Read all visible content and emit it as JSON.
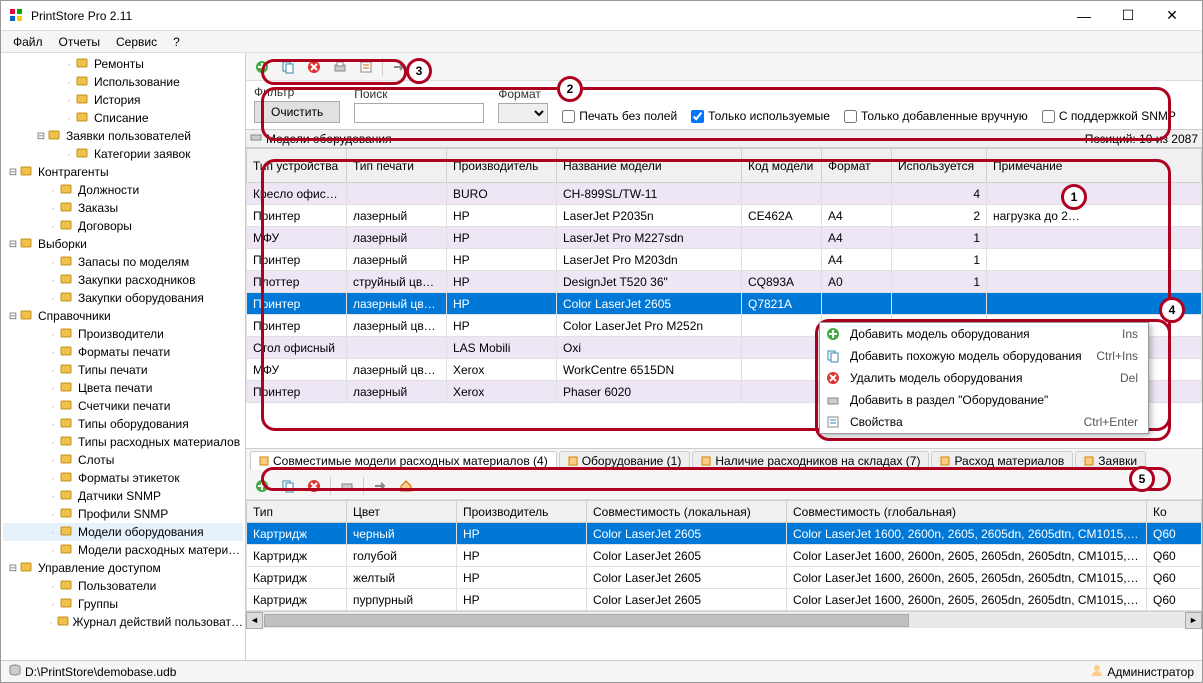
{
  "window": {
    "title": "PrintStore Pro 2.11"
  },
  "menu": {
    "file": "Файл",
    "reports": "Отчеты",
    "service": "Сервис",
    "help": "?"
  },
  "tree": [
    {
      "l": 2,
      "label": "Ремонты",
      "ico": "wrench"
    },
    {
      "l": 2,
      "label": "Использование",
      "ico": "doc"
    },
    {
      "l": 2,
      "label": "История",
      "ico": "time"
    },
    {
      "l": 2,
      "label": "Списание",
      "ico": "doc"
    },
    {
      "l": 1,
      "exp": "-",
      "label": "Заявки пользователей",
      "ico": "folder"
    },
    {
      "l": 2,
      "label": "Категории заявок",
      "ico": "tag"
    },
    {
      "l": 0,
      "exp": "-",
      "label": "Контрагенты",
      "ico": "contacts"
    },
    {
      "l": "1nb",
      "label": "Должности",
      "ico": "card"
    },
    {
      "l": "1nb",
      "label": "Заказы",
      "ico": "cart"
    },
    {
      "l": "1nb",
      "label": "Договоры",
      "ico": "doc"
    },
    {
      "l": 0,
      "exp": "-",
      "label": "Выборки",
      "ico": "filter"
    },
    {
      "l": "1nb",
      "label": "Запасы по моделям",
      "ico": "box"
    },
    {
      "l": "1nb",
      "label": "Закупки расходников",
      "ico": "cart"
    },
    {
      "l": "1nb",
      "label": "Закупки оборудования",
      "ico": "cart"
    },
    {
      "l": 0,
      "exp": "-",
      "label": "Справочники",
      "ico": "book"
    },
    {
      "l": "1nb",
      "label": "Производители",
      "ico": "factory"
    },
    {
      "l": "1nb",
      "label": "Форматы печати",
      "ico": "page"
    },
    {
      "l": "1nb",
      "label": "Типы печати",
      "ico": "brush"
    },
    {
      "l": "1nb",
      "label": "Цвета печати",
      "ico": "palette"
    },
    {
      "l": "1nb",
      "label": "Счетчики печати",
      "ico": "counter"
    },
    {
      "l": "1nb",
      "label": "Типы оборудования",
      "ico": "mouse"
    },
    {
      "l": "1nb",
      "label": "Типы расходных материалов",
      "ico": "ink"
    },
    {
      "l": "1nb",
      "label": "Слоты",
      "ico": "slot"
    },
    {
      "l": "1nb",
      "label": "Форматы этикеток",
      "ico": "label"
    },
    {
      "l": "1nb",
      "label": "Датчики SNMP",
      "ico": "sensor"
    },
    {
      "l": "1nb",
      "label": "Профили SNMP",
      "ico": "profile"
    },
    {
      "l": "1nb",
      "label": "Модели оборудования",
      "ico": "printer",
      "selected": true
    },
    {
      "l": "1nb",
      "label": "Модели расходных матери…",
      "ico": "ink"
    },
    {
      "l": 0,
      "exp": "-",
      "label": "Управление доступом",
      "ico": "key"
    },
    {
      "l": "1nb",
      "label": "Пользователи",
      "ico": "user"
    },
    {
      "l": "1nb",
      "label": "Группы",
      "ico": "group"
    },
    {
      "l": "1nb",
      "label": "Журнал действий пользоват…",
      "ico": "log"
    }
  ],
  "filter": {
    "filter_label": "Фильтр",
    "clear_btn": "Очистить",
    "search_label": "Поиск",
    "format_label": "Формат",
    "chk_nofields": "Печать без полей",
    "chk_used": "Только используемые",
    "chk_manual": "Только добавленные вручную",
    "chk_snmp": "С поддержкой SNMP"
  },
  "panel": {
    "title": "Модели оборудования",
    "position": "Позиций: 10 из 2087"
  },
  "grid1": {
    "cols": [
      "Тип устройства",
      "Тип печати",
      "Производитель",
      "Название модели",
      "Код модели",
      "Формат",
      "Используется",
      "Примечание"
    ],
    "rows": [
      {
        "alt": true,
        "c": [
          "Кресло офисн…",
          "",
          "BURO",
          "CH-899SL/TW-11",
          "",
          "",
          "4",
          ""
        ]
      },
      {
        "c": [
          "Принтер",
          "лазерный",
          "HP",
          "LaserJet P2035n",
          "CE462A",
          "A4",
          "2",
          "нагрузка до 2…"
        ]
      },
      {
        "alt": true,
        "c": [
          "МФУ",
          "лазерный",
          "HP",
          "LaserJet Pro M227sdn",
          "",
          "A4",
          "1",
          ""
        ]
      },
      {
        "c": [
          "Принтер",
          "лазерный",
          "HP",
          "LaserJet Pro M203dn",
          "",
          "A4",
          "1",
          ""
        ]
      },
      {
        "alt": true,
        "c": [
          "Плоттер",
          "струйный цве…",
          "HP",
          "DesignJet T520 36\"",
          "CQ893A",
          "A0",
          "1",
          ""
        ]
      },
      {
        "sel": true,
        "c": [
          "Принтер",
          "лазерный цве…",
          "HP",
          "Color LaserJet 2605",
          "Q7821A",
          "",
          "",
          ""
        ]
      },
      {
        "c": [
          "Принтер",
          "лазерный цве…",
          "HP",
          "Color LaserJet Pro M252n",
          "",
          "",
          "",
          ""
        ]
      },
      {
        "alt": true,
        "c": [
          "Стол офисный",
          "",
          "LAS Mobili",
          "Oxi",
          "",
          "",
          "",
          ""
        ]
      },
      {
        "c": [
          "МФУ",
          "лазерный цве…",
          "Xerox",
          "WorkCentre 6515DN",
          "",
          "",
          "",
          ""
        ]
      },
      {
        "alt": true,
        "c": [
          "Принтер",
          "лазерный",
          "Xerox",
          "Phaser 6020",
          "",
          "",
          "",
          ""
        ]
      }
    ]
  },
  "context": {
    "items": [
      {
        "ico": "add",
        "label": "Добавить модель оборудования",
        "short": "Ins"
      },
      {
        "ico": "copy",
        "label": "Добавить похожую модель оборудования",
        "short": "Ctrl+Ins"
      },
      {
        "ico": "del",
        "label": "Удалить модель оборудования",
        "short": "Del"
      },
      {
        "ico": "move",
        "label": "Добавить в раздел \"Оборудование\"",
        "short": ""
      },
      {
        "ico": "props",
        "label": "Свойства",
        "short": "Ctrl+Enter"
      }
    ]
  },
  "tabs": [
    {
      "label": "Совместимые модели расходных материалов (4)",
      "active": true
    },
    {
      "label": "Оборудование (1)"
    },
    {
      "label": "Наличие расходников на складах (7)"
    },
    {
      "label": "Расход материалов"
    },
    {
      "label": "Заявки"
    }
  ],
  "grid2": {
    "cols": [
      "Тип",
      "Цвет",
      "Производитель",
      "Совместимость (локальная)",
      "Совместимость (глобальная)",
      "Ко"
    ],
    "rows": [
      {
        "sel": true,
        "c": [
          "Картридж",
          "черный",
          "HP",
          "Color LaserJet 2605",
          "Color LaserJet 1600, 2600n, 2605, 2605dn, 2605dtn, CM1015, …",
          "Q60"
        ]
      },
      {
        "c": [
          "Картридж",
          "голубой",
          "HP",
          "Color LaserJet 2605",
          "Color LaserJet 1600, 2600n, 2605, 2605dn, 2605dtn, CM1015, …",
          "Q60"
        ]
      },
      {
        "c": [
          "Картридж",
          "желтый",
          "HP",
          "Color LaserJet 2605",
          "Color LaserJet 1600, 2600n, 2605, 2605dn, 2605dtn, CM1015, …",
          "Q60"
        ]
      },
      {
        "c": [
          "Картридж",
          "пурпурный",
          "HP",
          "Color LaserJet 2605",
          "Color LaserJet 1600, 2600n, 2605, 2605dn, 2605dtn, CM1015, …",
          "Q60"
        ]
      }
    ]
  },
  "status": {
    "db": "D:\\PrintStore\\demobase.udb",
    "user": "Администратор"
  },
  "markers": {
    "1": "1",
    "2": "2",
    "3": "3",
    "4": "4",
    "5": "5"
  }
}
